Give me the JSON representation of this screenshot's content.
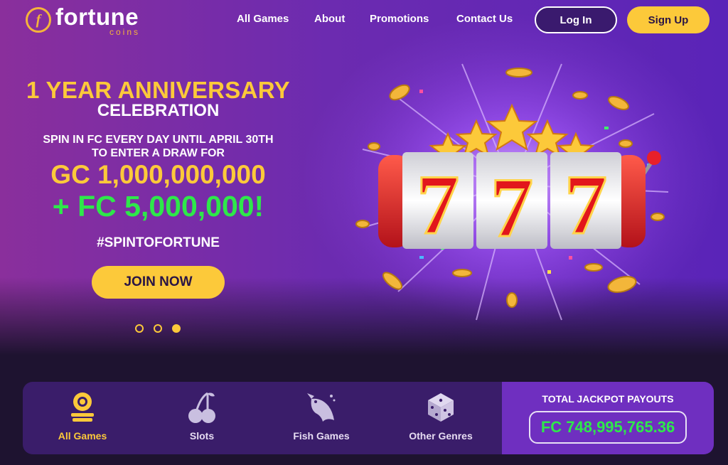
{
  "header": {
    "logo": {
      "word": "fortune",
      "sub": "coins",
      "badge": "f"
    },
    "nav": [
      "All Games",
      "About",
      "Promotions",
      "Contact Us"
    ],
    "login_label": "Log In",
    "signup_label": "Sign Up"
  },
  "hero": {
    "line1": "1 YEAR ANNIVERSARY",
    "line2": "CELEBRATION",
    "line3": "SPIN IN FC EVERY DAY UNTIL APRIL 30TH",
    "line4": "TO ENTER A DRAW FOR",
    "gc_prize": "GC 1,000,000,000",
    "fc_prize": "+ FC 5,000,000!",
    "hashtag": "#SPINTOFORTUNE",
    "cta": "JOIN NOW",
    "reels": [
      "7",
      "7",
      "7"
    ],
    "carousel_active_index": 2
  },
  "categories": [
    {
      "label": "All Games",
      "icon": "chip-stack-icon",
      "active": true
    },
    {
      "label": "Slots",
      "icon": "cherries-icon",
      "active": false
    },
    {
      "label": "Fish Games",
      "icon": "fish-icon",
      "active": false
    },
    {
      "label": "Other Genres",
      "icon": "dice-icon",
      "active": false
    }
  ],
  "jackpot": {
    "title": "TOTAL JACKPOT PAYOUTS",
    "value": "FC 748,995,765.36"
  },
  "colors": {
    "accent_yellow": "#fcc93a",
    "accent_green": "#2ee84a",
    "hero_purple": "#6c2bb0",
    "bar_purple": "#3a1d6a",
    "jackpot_purple": "#6f2fc0"
  }
}
